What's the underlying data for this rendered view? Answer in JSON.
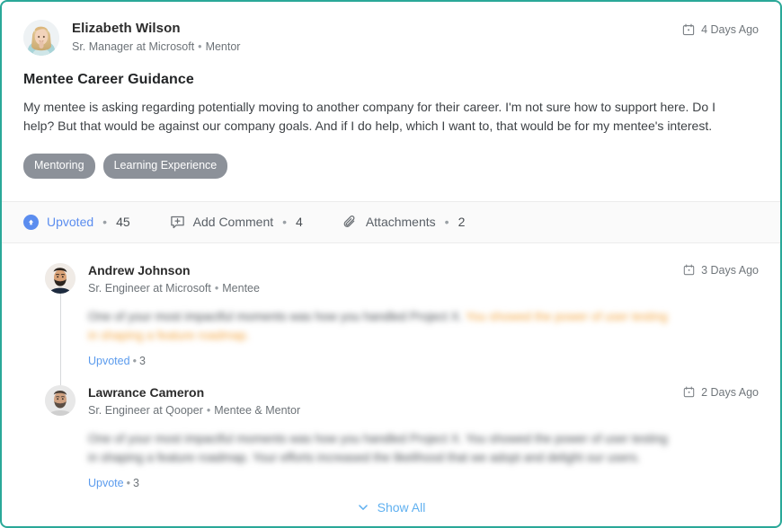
{
  "theme": {
    "card_border": "#2aa898",
    "link_blue": "#5b8def",
    "comment_link_blue": "#5b9bed",
    "show_all_blue": "#5fb0f0",
    "tag_bg": "#8c9199",
    "highlight_orange": "#f2a33c",
    "action_bar_bg": "#fafafa"
  },
  "post": {
    "author": {
      "name": "Elizabeth Wilson",
      "role": "Sr. Manager at Microsoft",
      "separator": "•",
      "membership": "Mentor",
      "avatar_icon": "avatar-photo-woman"
    },
    "timestamp": {
      "icon": "calendar-icon",
      "label": "4 Days Ago"
    },
    "title": "Mentee Career Guidance",
    "body": "My mentee is asking regarding potentially moving to another company for their career. I'm not sure how to support here. Do I help? But that would be against our company goals. And if I do help, which I want to, that would be for my mentee's interest.",
    "tags": [
      {
        "label": "Mentoring"
      },
      {
        "label": "Learning Experience"
      }
    ]
  },
  "actions": [
    {
      "id": "upvote",
      "icon": "arrow-up-circle-icon",
      "label": "Upvoted",
      "active": true,
      "separator": "•",
      "count": "45"
    },
    {
      "id": "add-comment",
      "icon": "comment-plus-icon",
      "label": "Add Comment",
      "active": false,
      "separator": "•",
      "count": "4"
    },
    {
      "id": "attachments",
      "icon": "paperclip-icon",
      "label": "Attachments",
      "active": false,
      "separator": "•",
      "count": "2"
    }
  ],
  "comments": [
    {
      "author": {
        "name": "Andrew Johnson",
        "role": "Sr. Engineer at Microsoft",
        "separator": "•",
        "membership": "Mentee",
        "avatar_icon": "avatar-photo-man-beard"
      },
      "timestamp": {
        "icon": "calendar-icon",
        "label": "3 Days Ago"
      },
      "text_plain": "One of your most impactful moments was how you handled Project X.",
      "text_highlighted": "You showed the power of user testing in shaping a feature roadmap.",
      "upvote_label": "Upvoted",
      "separator": "•",
      "upvote_count": "3"
    },
    {
      "author": {
        "name": "Lawrance Cameron",
        "role": "Sr. Engineer at Qooper",
        "separator": "•",
        "membership": "Mentee & Mentor",
        "avatar_icon": "avatar-photo-man-short-beard"
      },
      "timestamp": {
        "icon": "calendar-icon",
        "label": "2 Days Ago"
      },
      "text_plain": "One of your most impactful moments was how you handled Project X. You showed the power of user testing in shaping a feature roadmap. Your efforts increased the likelihood that we adopt and delight our users.",
      "text_highlighted": "",
      "upvote_label": "Upvote",
      "separator": "•",
      "upvote_count": "3"
    }
  ],
  "footer": {
    "show_all_label": "Show All",
    "show_all_icon": "chevron-down-icon"
  }
}
